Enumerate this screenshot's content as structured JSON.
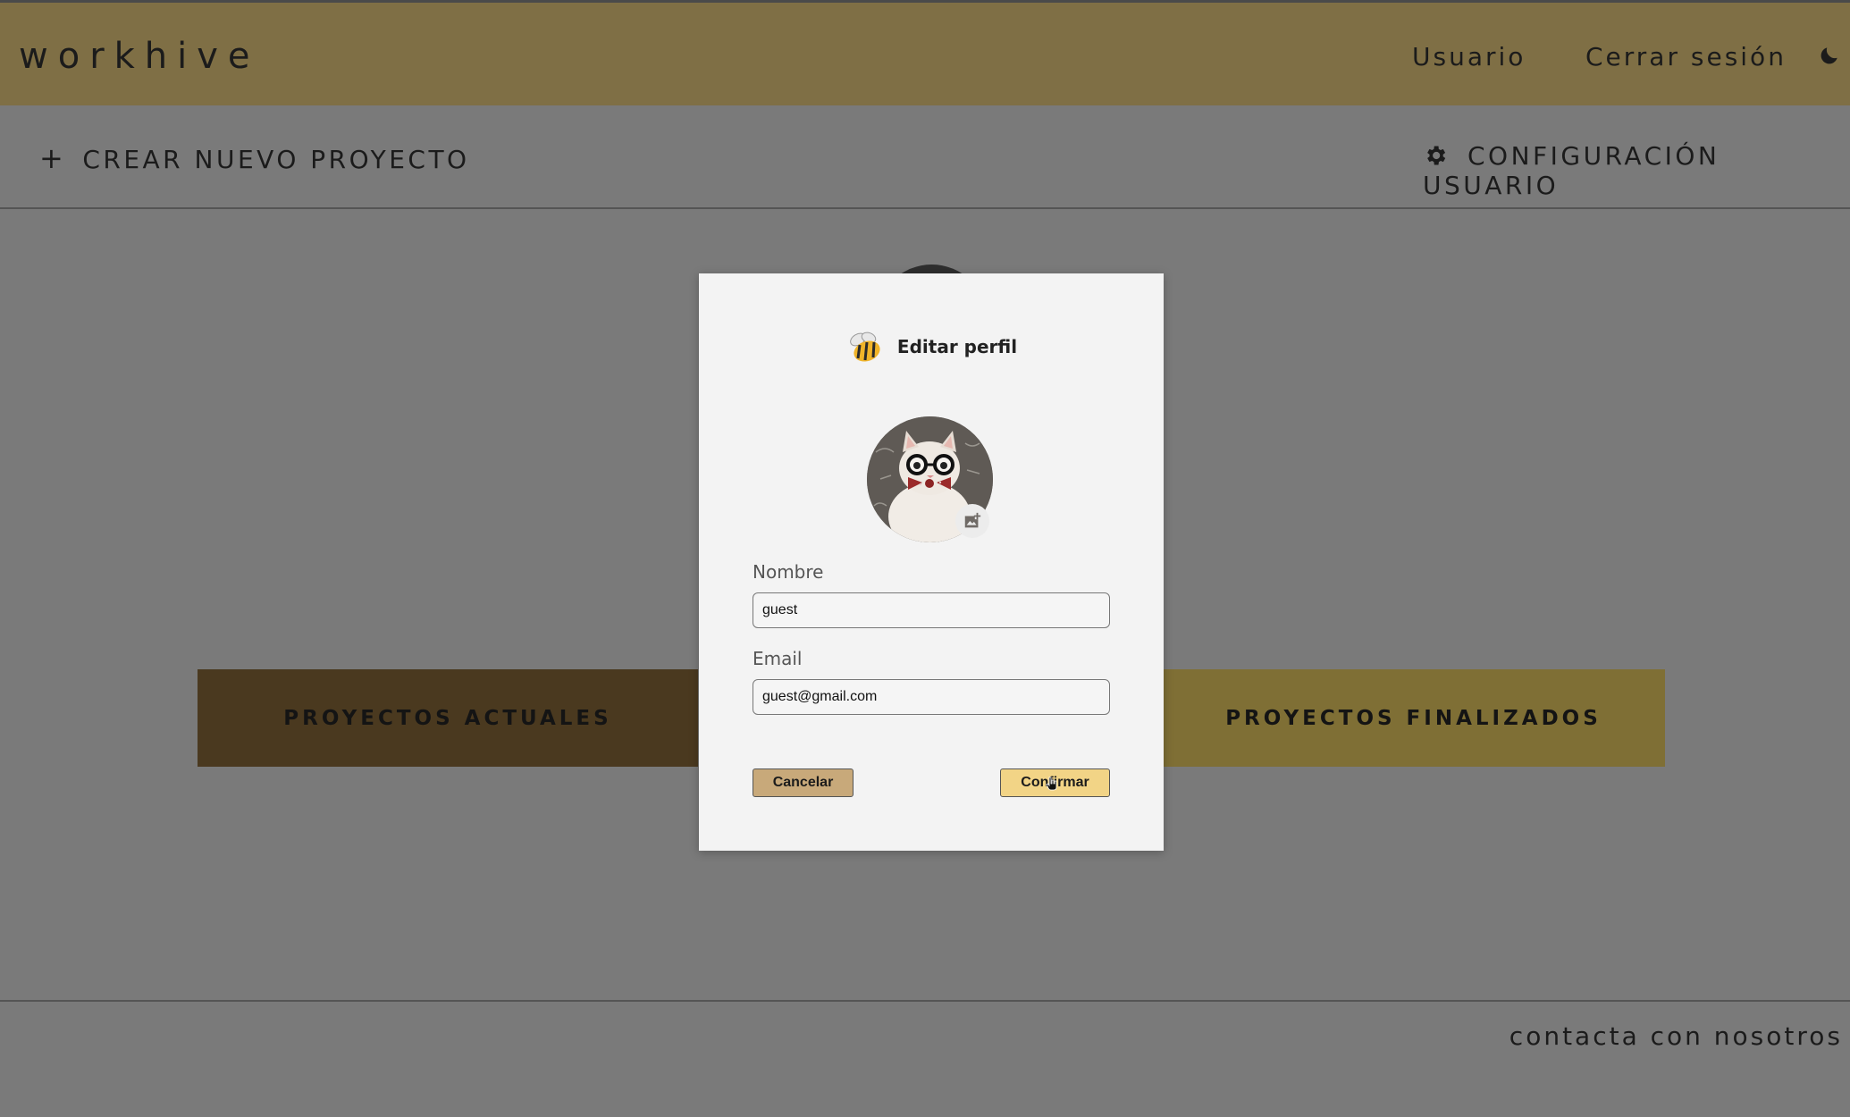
{
  "app": {
    "brand": "workhive",
    "nav": {
      "user": "Usuario",
      "logout": "Cerrar sesión"
    }
  },
  "actions": {
    "create_project": "CREAR NUEVO PROYECTO",
    "create_icon": "+",
    "user_config": "CONFIGURACIÓN USUARIO"
  },
  "tabs": {
    "current": "PROYECTOS ACTUALES",
    "finished": "PROYECTOS FINALIZADOS"
  },
  "footer": {
    "contact": "contacta con nosotros"
  },
  "modal": {
    "title": "Editar perfil",
    "name_label": "Nombre",
    "name_value": "guest",
    "email_label": "Email",
    "email_value": "guest@gmail.com",
    "cancel": "Cancelar",
    "confirm": "Confirmar"
  },
  "icons": {
    "theme": "moon-icon",
    "settings": "gear-icon",
    "logo": "bee-icon",
    "change_photo": "add-photo-icon"
  },
  "colors": {
    "header": "#7f6f45",
    "tab_current": "#4a391f",
    "tab_finished": "#7f6f35",
    "cancel_button": "#c8a97a",
    "confirm_button": "#f2d486"
  }
}
